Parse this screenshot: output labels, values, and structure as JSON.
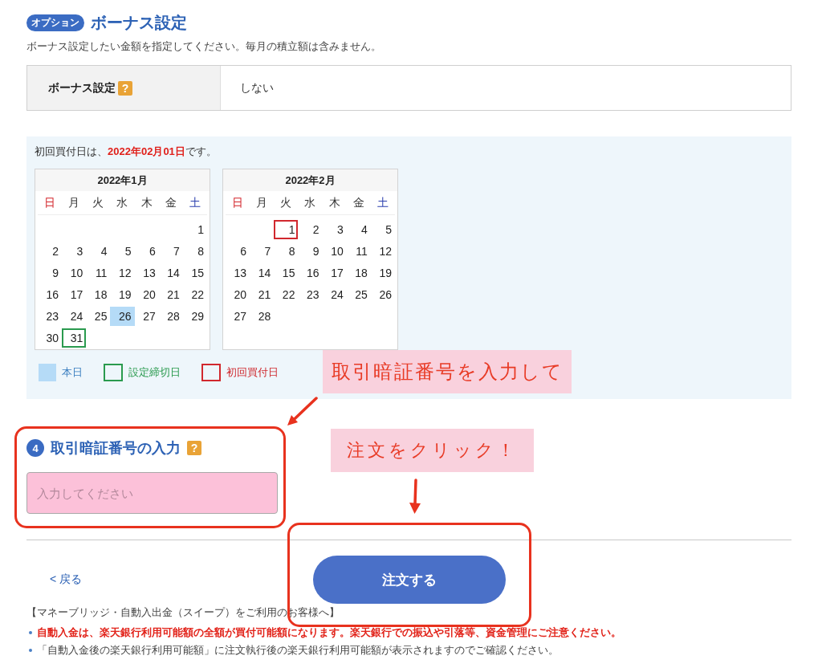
{
  "bonus": {
    "badge": "オプション",
    "title": "ボーナス設定",
    "description": "ボーナス設定したい金額を指定してください。毎月の積立額は含みません。",
    "table": {
      "label": "ボーナス設定",
      "help": "?",
      "value": "しない"
    }
  },
  "schedule": {
    "notice": "初回買付日は、**2022年02月01日**です。",
    "calendars": [
      {
        "title": "2022年1月",
        "weekdays": [
          {
            "label": "日",
            "color": "#d3262c"
          },
          {
            "label": "月"
          },
          {
            "label": "火"
          },
          {
            "label": "水"
          },
          {
            "label": "木"
          },
          {
            "label": "金"
          },
          {
            "label": "土",
            "color": "#2b3fae"
          }
        ],
        "weeks": [
          {
            "sat": {
              "day": "1",
              "today": false,
              "deadline": false,
              "first_buy": false
            }
          },
          {
            "sun": {
              "day": "2",
              "today": false,
              "deadline": false,
              "first_buy": false
            },
            "mon": {
              "day": "3",
              "today": false,
              "deadline": false,
              "first_buy": false
            },
            "tue": {
              "day": "4",
              "today": false,
              "deadline": false,
              "first_buy": false
            },
            "wed": {
              "day": "5",
              "today": false,
              "deadline": false,
              "first_buy": false
            },
            "thu": {
              "day": "6",
              "today": false,
              "deadline": false,
              "first_buy": false
            },
            "fri": {
              "day": "7",
              "today": false,
              "deadline": false,
              "first_buy": false
            },
            "sat": {
              "day": "8",
              "today": false,
              "deadline": false,
              "first_buy": false
            }
          },
          {
            "sun": {
              "day": "9",
              "today": false,
              "deadline": false,
              "first_buy": false
            },
            "mon": {
              "day": "10",
              "today": false,
              "deadline": false,
              "first_buy": false
            },
            "tue": {
              "day": "11",
              "today": false,
              "deadline": false,
              "first_buy": false
            },
            "wed": {
              "day": "12",
              "today": false,
              "deadline": false,
              "first_buy": false
            },
            "thu": {
              "day": "13",
              "today": false,
              "deadline": false,
              "first_buy": false
            },
            "fri": {
              "day": "14",
              "today": false,
              "deadline": false,
              "first_buy": false
            },
            "sat": {
              "day": "15",
              "today": false,
              "deadline": false,
              "first_buy": false
            }
          },
          {
            "sun": {
              "day": "16",
              "today": false,
              "deadline": false,
              "first_buy": false
            },
            "mon": {
              "day": "17",
              "today": false,
              "deadline": false,
              "first_buy": false
            },
            "tue": {
              "day": "18",
              "today": false,
              "deadline": false,
              "first_buy": false
            },
            "wed": {
              "day": "19",
              "today": false,
              "deadline": false,
              "first_buy": false
            },
            "thu": {
              "day": "20",
              "today": false,
              "deadline": false,
              "first_buy": false
            },
            "fri": {
              "day": "21",
              "today": false,
              "deadline": false,
              "first_buy": false
            },
            "sat": {
              "day": "22",
              "today": false,
              "deadline": false,
              "first_buy": false
            }
          },
          {
            "sun": {
              "day": "23",
              "today": false,
              "deadline": false,
              "first_buy": false
            },
            "mon": {
              "day": "24",
              "today": false,
              "deadline": false,
              "first_buy": false
            },
            "tue": {
              "day": "25",
              "today": false,
              "deadline": false,
              "first_buy": false
            },
            "wed": {
              "day": "26",
              "today": true,
              "deadline": false,
              "first_buy": false
            },
            "thu": {
              "day": "27",
              "today": false,
              "deadline": false,
              "first_buy": false
            },
            "fri": {
              "day": "28",
              "today": false,
              "deadline": false,
              "first_buy": false
            },
            "sat": {
              "day": "29",
              "today": false,
              "deadline": false,
              "first_buy": false
            }
          },
          {
            "sun": {
              "day": "30",
              "today": false,
              "deadline": false,
              "first_buy": false
            },
            "mon": {
              "day": "31",
              "today": false,
              "deadline": true,
              "first_buy": false
            }
          }
        ]
      },
      {
        "title": "2022年2月",
        "weekdays": [
          {
            "label": "日",
            "color": "#d3262c"
          },
          {
            "label": "月"
          },
          {
            "label": "火"
          },
          {
            "label": "水"
          },
          {
            "label": "木"
          },
          {
            "label": "金"
          },
          {
            "label": "土",
            "color": "#2b3fae"
          }
        ],
        "weeks": [
          {
            "tue": {
              "day": "1",
              "today": false,
              "deadline": false,
              "first_buy": true
            },
            "wed": {
              "day": "2",
              "today": false,
              "deadline": false,
              "first_buy": false
            },
            "thu": {
              "day": "3",
              "today": false,
              "deadline": false,
              "first_buy": false
            },
            "fri": {
              "day": "4",
              "today": false,
              "deadline": false,
              "first_buy": false
            },
            "sat": {
              "day": "5",
              "today": false,
              "deadline": false,
              "first_buy": false
            }
          },
          {
            "sun": {
              "day": "6",
              "today": false,
              "deadline": false,
              "first_buy": false
            },
            "mon": {
              "day": "7",
              "today": false,
              "deadline": false,
              "first_buy": false
            },
            "tue": {
              "day": "8",
              "today": false,
              "deadline": false,
              "first_buy": false
            },
            "wed": {
              "day": "9",
              "today": false,
              "deadline": false,
              "first_buy": false
            },
            "thu": {
              "day": "10",
              "today": false,
              "deadline": false,
              "first_buy": false
            },
            "fri": {
              "day": "11",
              "today": false,
              "deadline": false,
              "first_buy": false
            },
            "sat": {
              "day": "12",
              "today": false,
              "deadline": false,
              "first_buy": false
            }
          },
          {
            "sun": {
              "day": "13",
              "today": false,
              "deadline": false,
              "first_buy": false
            },
            "mon": {
              "day": "14",
              "today": false,
              "deadline": false,
              "first_buy": false
            },
            "tue": {
              "day": "15",
              "today": false,
              "deadline": false,
              "first_buy": false
            },
            "wed": {
              "day": "16",
              "today": false,
              "deadline": false,
              "first_buy": false
            },
            "thu": {
              "day": "17",
              "today": false,
              "deadline": false,
              "first_buy": false
            },
            "fri": {
              "day": "18",
              "today": false,
              "deadline": false,
              "first_buy": false
            },
            "sat": {
              "day": "19",
              "today": false,
              "deadline": false,
              "first_buy": false
            }
          },
          {
            "sun": {
              "day": "20",
              "today": false,
              "deadline": false,
              "first_buy": false
            },
            "mon": {
              "day": "21",
              "today": false,
              "deadline": false,
              "first_buy": false
            },
            "tue": {
              "day": "22",
              "today": false,
              "deadline": false,
              "first_buy": false
            },
            "wed": {
              "day": "23",
              "today": false,
              "deadline": false,
              "first_buy": false
            },
            "thu": {
              "day": "24",
              "today": false,
              "deadline": false,
              "first_buy": false
            },
            "fri": {
              "day": "25",
              "today": false,
              "deadline": false,
              "first_buy": false
            },
            "sat": {
              "day": "26",
              "today": false,
              "deadline": false,
              "first_buy": false
            }
          },
          {
            "sun": {
              "day": "27",
              "today": false,
              "deadline": false,
              "first_buy": false
            },
            "mon": {
              "day": "28",
              "today": false,
              "deadline": false,
              "first_buy": false
            }
          }
        ]
      }
    ],
    "legend": [
      {
        "label": "本日",
        "kind": "today"
      },
      {
        "label": "設定締切日",
        "kind": "deadline"
      },
      {
        "label": "初回買付日",
        "kind": "first_buy"
      }
    ]
  },
  "pin": {
    "step": "4",
    "title": "取引暗証番号の入力",
    "help": "?",
    "placeholder": "入力してください"
  },
  "actions": {
    "back": "< 戻る",
    "submit": "注文する"
  },
  "notes": {
    "heading": "【マネーブリッジ・自動入出金（スイープ）をご利用のお客様へ】",
    "items": [
      {
        "kind": "warning",
        "text": "自動入金は、楽天銀行利用可能額の全額が買付可能額になります。楽天銀行での振込や引落等、資金管理にご注意ください。"
      },
      {
        "kind": "info",
        "text": "「自動入金後の楽天銀行利用可能額」に注文執行後の楽天銀行利用可能額が表示されますのでご確認ください。"
      }
    ]
  },
  "annotations": [
    {
      "text": "取引暗証番号を入力して"
    },
    {
      "text": "注文をクリック！"
    }
  ]
}
